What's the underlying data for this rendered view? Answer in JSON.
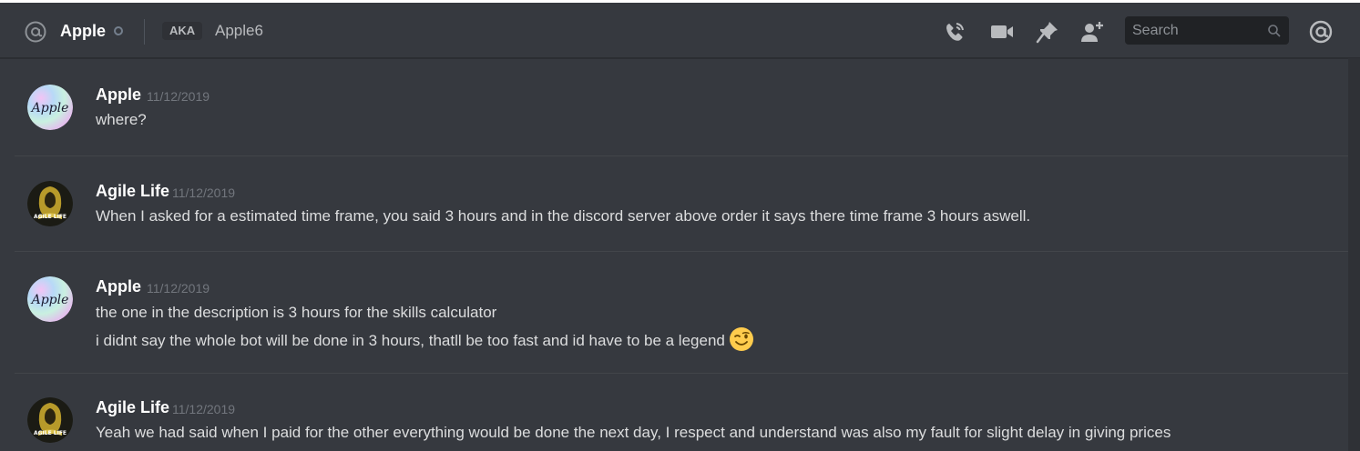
{
  "header": {
    "title": "Apple",
    "aka_badge": "AKA",
    "aka_name": "Apple6",
    "search_placeholder": "Search",
    "icons": [
      "at-icon",
      "status-offline-icon",
      "voice-call-icon",
      "video-call-icon",
      "pin-icon",
      "add-friend-icon",
      "search-icon",
      "mentions-icon"
    ]
  },
  "messages": [
    {
      "author": "Apple",
      "timestamp": "11/12/2019",
      "avatar": "apple-avatar",
      "lines": [
        "where?"
      ]
    },
    {
      "author": "Agile Life",
      "timestamp": "11/12/2019",
      "avatar": "agile-life-avatar",
      "lines": [
        "When I asked for a estimated time frame, you said 3 hours and in the discord server above order it says there time frame 3 hours aswell."
      ]
    },
    {
      "author": "Apple",
      "timestamp": "11/12/2019",
      "avatar": "apple-avatar",
      "lines": [
        "the one in the description is 3 hours for the skills calculator",
        "i didnt say the whole bot will be done in 3 hours, thatll be too fast and id have to be a legend"
      ],
      "emoji": "winking-face-emoji"
    },
    {
      "author": "Agile Life",
      "timestamp": "11/12/2019",
      "avatar": "agile-life-avatar",
      "lines": [
        "Yeah we had said when I paid for the other everything would be done the next day, I respect and understand was also my fault for slight delay in giving prices"
      ]
    }
  ],
  "colors": {
    "background": "#36393f",
    "author": "#ffffff",
    "timestamp": "#72767d",
    "message_text": "#dcddde",
    "header_icon": "#b9bbbe",
    "search_bg": "#202225"
  }
}
